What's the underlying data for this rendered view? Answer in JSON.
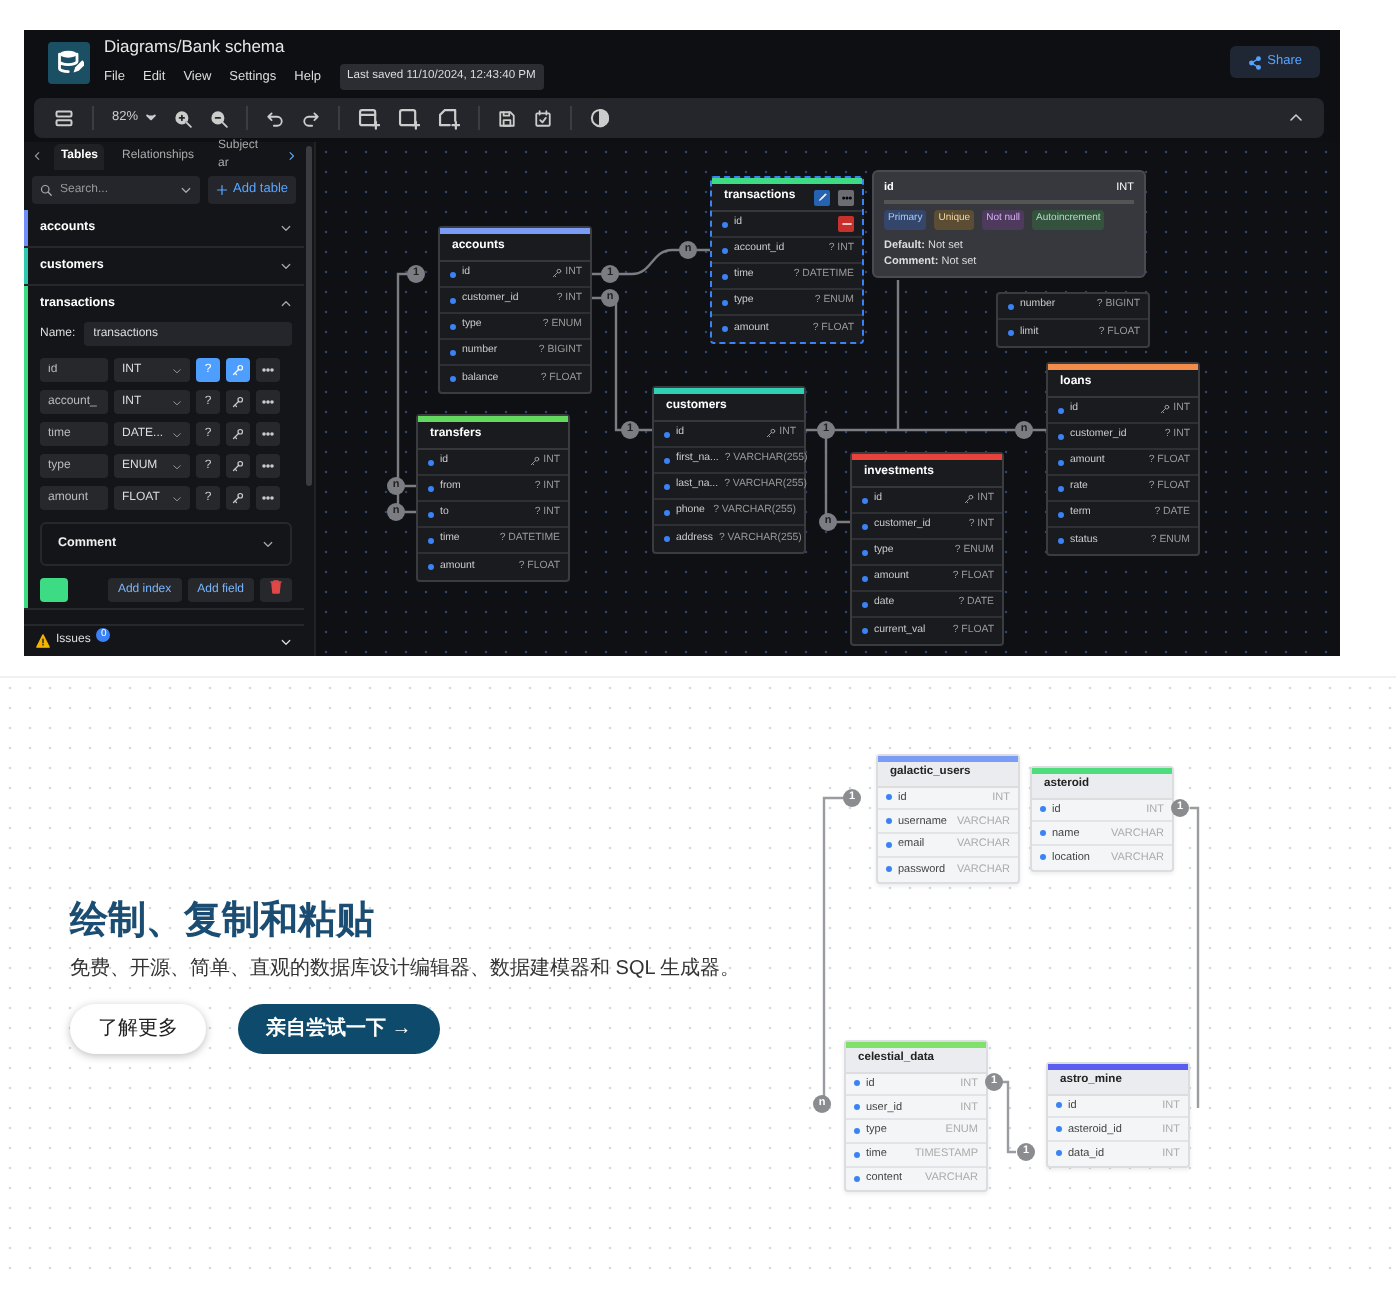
{
  "app": {
    "title": "Diagrams/Bank schema",
    "menu": [
      "File",
      "Edit",
      "View",
      "Settings",
      "Help"
    ],
    "last_saved": "Last saved 11/10/2024, 12:43:40 PM",
    "share": "Share",
    "zoom": "82%"
  },
  "sidebar": {
    "tabs": [
      {
        "label": "Tables",
        "selected": true
      },
      {
        "label": "Relationships",
        "selected": false
      },
      {
        "label": "Subject ar",
        "selected": false
      }
    ],
    "search": {
      "placeholder": "Search..."
    },
    "add_table": "Add table",
    "tables": [
      {
        "name": "accounts",
        "color": "#6f8ef7",
        "expanded": false
      },
      {
        "name": "customers",
        "color": "#2fc8b0",
        "expanded": false
      },
      {
        "name": "transactions",
        "color": "#3ddc84",
        "expanded": true,
        "name_label": "Name:",
        "name_value": "transactions",
        "comment": "Comment",
        "add_index": "Add index",
        "add_field": "Add field",
        "fields": [
          {
            "name": "id",
            "type": "INT",
            "null_button": "?",
            "notnull": true,
            "primary": true
          },
          {
            "name": "account_",
            "type": "INT",
            "null_button": "?",
            "notnull": false,
            "primary": false
          },
          {
            "name": "time",
            "type": "DATE...",
            "null_button": "?",
            "notnull": false,
            "primary": false
          },
          {
            "name": "type",
            "type": "ENUM",
            "null_button": "?",
            "notnull": false,
            "primary": false
          },
          {
            "name": "amount",
            "type": "FLOAT",
            "null_button": "?",
            "notnull": false,
            "primary": false
          }
        ]
      }
    ],
    "issues": {
      "label": "Issues",
      "count": "0"
    }
  },
  "canvas": {
    "tables": [
      {
        "name": "accounts",
        "color": "#7b9cf4",
        "selected": false,
        "rows": [
          {
            "name": "id",
            "type": "INT",
            "pk": true
          },
          {
            "name": "customer_id",
            "type": "? INT",
            "pk": false
          },
          {
            "name": "type",
            "type": "? ENUM",
            "pk": false
          },
          {
            "name": "number",
            "type": "? BIGINT",
            "pk": false
          },
          {
            "name": "balance",
            "type": "? FLOAT",
            "pk": false
          }
        ]
      },
      {
        "name": "transactions",
        "color": "#3ddc84",
        "selected": true,
        "rows": [
          {
            "name": "id",
            "pk": false,
            "hovered": true
          },
          {
            "name": "account_id",
            "type": "? INT",
            "pk": false
          },
          {
            "name": "time",
            "type": "? DATETIME",
            "pk": false
          },
          {
            "name": "type",
            "type": "? ENUM",
            "pk": false
          },
          {
            "name": "amount",
            "type": "? FLOAT",
            "pk": false
          }
        ]
      },
      {
        "name": "transfers",
        "color": "#62d85f",
        "selected": false,
        "rows": [
          {
            "name": "id",
            "type": "INT",
            "pk": true
          },
          {
            "name": "from",
            "type": "? INT",
            "pk": false
          },
          {
            "name": "to",
            "type": "? INT",
            "pk": false
          },
          {
            "name": "time",
            "type": "? DATETIME",
            "pk": false
          },
          {
            "name": "amount",
            "type": "? FLOAT",
            "pk": false
          }
        ]
      },
      {
        "name": "customers",
        "color": "#2fd1b3",
        "selected": false,
        "rows": [
          {
            "name": "id",
            "type": "INT",
            "pk": true
          },
          {
            "name": "first_na...",
            "type": "? VARCHAR(255)",
            "pk": false
          },
          {
            "name": "last_na...",
            "type": "? VARCHAR(255)",
            "pk": false
          },
          {
            "name": "phone",
            "type": "? VARCHAR(255)",
            "pk": false
          },
          {
            "name": "address",
            "type": "? VARCHAR(255)",
            "pk": false
          }
        ]
      },
      {
        "name": "investments",
        "color": "#e8423b",
        "selected": false,
        "rows": [
          {
            "name": "id",
            "type": "INT",
            "pk": true
          },
          {
            "name": "customer_id",
            "type": "? INT",
            "pk": false
          },
          {
            "name": "type",
            "type": "? ENUM",
            "pk": false
          },
          {
            "name": "amount",
            "type": "? FLOAT",
            "pk": false
          },
          {
            "name": "date",
            "type": "? DATE",
            "pk": false
          },
          {
            "name": "current_val",
            "type": "? FLOAT",
            "pk": false
          }
        ]
      },
      {
        "name": "loans",
        "color": "#f28c4b",
        "selected": false,
        "rows": [
          {
            "name": "id",
            "type": "INT",
            "pk": true
          },
          {
            "name": "customer_id",
            "type": "? INT",
            "pk": false
          },
          {
            "name": "amount",
            "type": "? FLOAT",
            "pk": false
          },
          {
            "name": "rate",
            "type": "? FLOAT",
            "pk": false
          },
          {
            "name": "term",
            "type": "? DATE",
            "pk": false
          },
          {
            "name": "status",
            "type": "? ENUM",
            "pk": false
          }
        ]
      },
      {
        "selected": false,
        "rows": [
          {
            "name": "number",
            "type": "? BIGINT",
            "pk": false
          },
          {
            "name": "limit",
            "type": "? FLOAT",
            "pk": false
          }
        ]
      }
    ],
    "relationships": [
      {
        "from": "1",
        "to": "n"
      },
      {
        "to": "n"
      },
      {
        "from": "1",
        "to": "n"
      },
      {
        "from": "n",
        "to": "1"
      },
      {
        "from": "1",
        "to": "n"
      },
      {
        "to": "n"
      }
    ],
    "tooltip": {
      "name": "id",
      "type": "INT",
      "badges": [
        {
          "label": "Primary",
          "color": "#34476b"
        },
        {
          "label": "Unique",
          "color": "#5a4d33"
        },
        {
          "label": "Not null",
          "color": "#4d3a5c"
        },
        {
          "label": "Autoincrement",
          "color": "#35523f"
        }
      ],
      "default": "**Default:** Not set",
      "comment": "**Comment:** Not set"
    }
  },
  "hero": {
    "title": "绘制、复制和粘贴",
    "subtitle": "免费、开源、简单、直观的数据库设计编辑器、数据建模器和 SQL 生成器。",
    "learn_more": "了解更多",
    "try_it": "亲自尝试一下 →"
  },
  "preview": {
    "tables": [
      {
        "name": "galactic_users",
        "color": "#7b9cf4",
        "rows": [
          {
            "name": "id",
            "type": "INT"
          },
          {
            "name": "username",
            "type": "VARCHAR"
          },
          {
            "name": "email",
            "type": "VARCHAR"
          },
          {
            "name": "password",
            "type": "VARCHAR"
          }
        ]
      },
      {
        "name": "asteroid",
        "color": "#4fdc7c",
        "rows": [
          {
            "name": "id",
            "type": "INT"
          },
          {
            "name": "name",
            "type": "VARCHAR"
          },
          {
            "name": "location",
            "type": "VARCHAR"
          }
        ]
      },
      {
        "name": "celestial_data",
        "color": "#7fe06a",
        "rows": [
          {
            "name": "id",
            "type": "INT"
          },
          {
            "name": "user_id",
            "type": "INT"
          },
          {
            "name": "type",
            "type": "ENUM"
          },
          {
            "name": "time",
            "type": "TIMESTAMP"
          },
          {
            "name": "content",
            "type": "VARCHAR"
          }
        ]
      },
      {
        "name": "astro_mine",
        "color": "#5a5ef0",
        "rows": [
          {
            "name": "id",
            "type": "INT"
          },
          {
            "name": "asteroid_id",
            "type": "INT"
          },
          {
            "name": "data_id",
            "type": "INT"
          }
        ]
      }
    ],
    "relationships": [
      {
        "from": "1",
        "to": "n"
      },
      {
        "from": "1"
      },
      {
        "from": "1",
        "to": "1"
      }
    ]
  }
}
